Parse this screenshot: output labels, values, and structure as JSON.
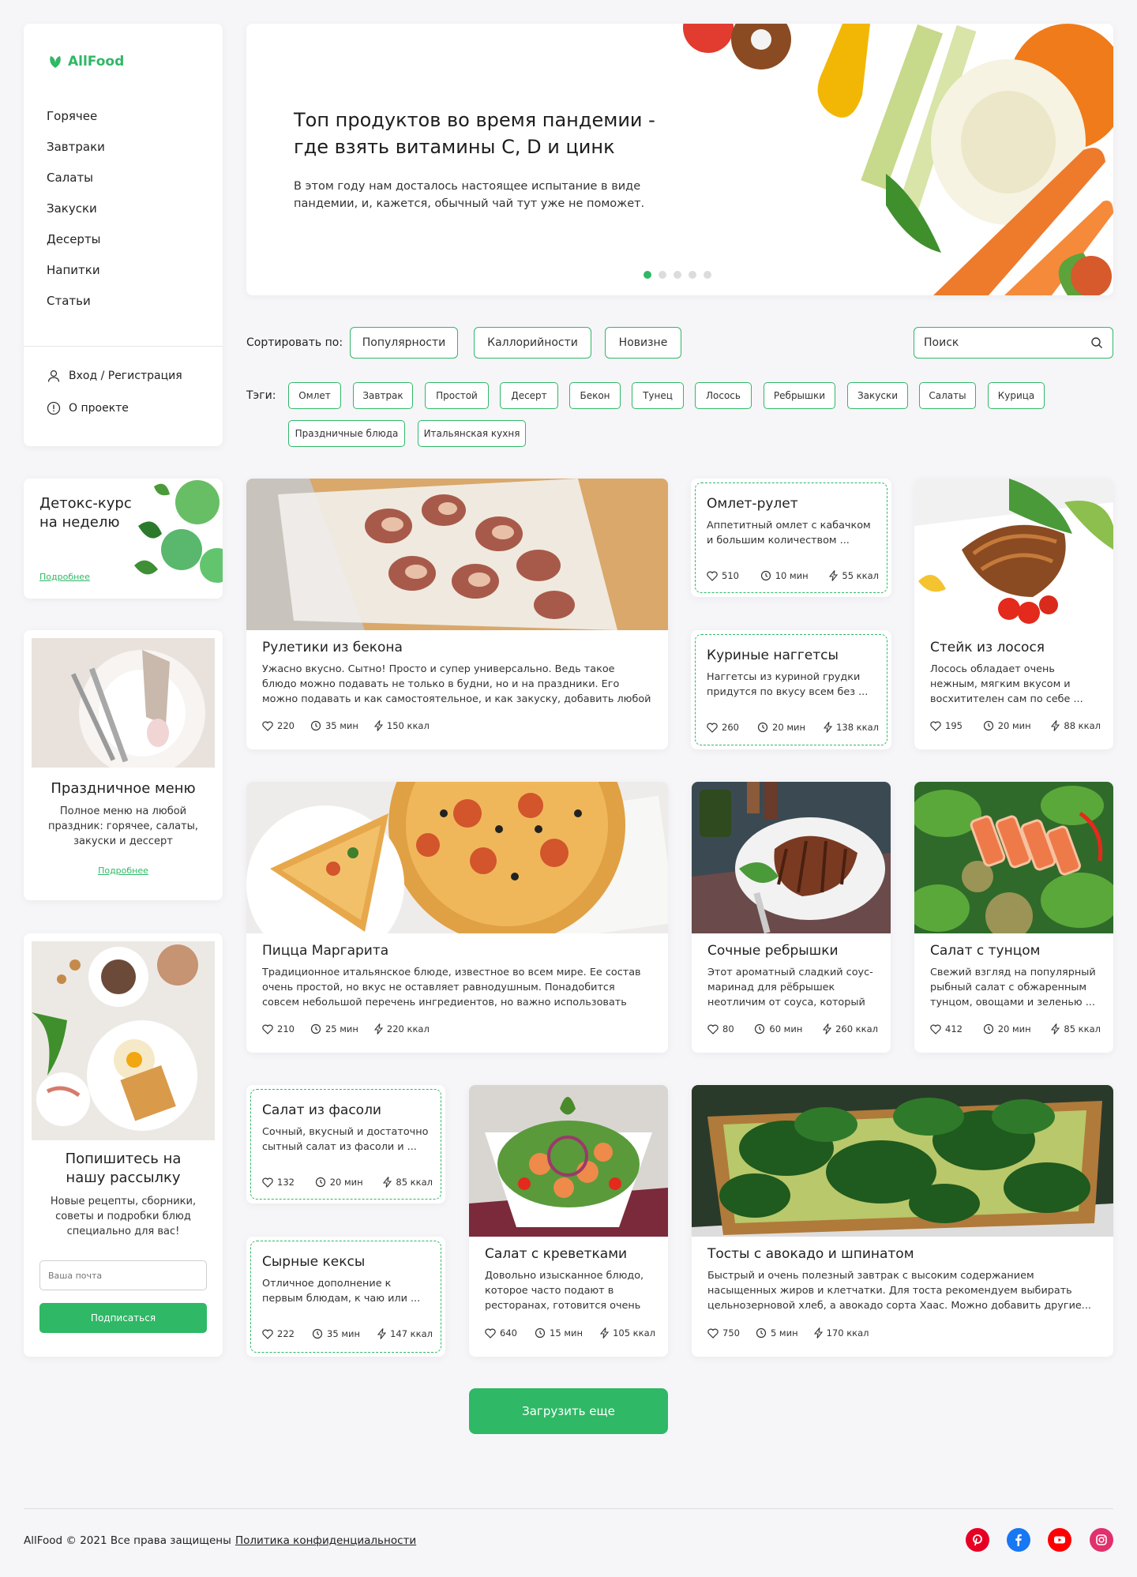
{
  "brand": {
    "name": "AllFood",
    "accent": "#2fb866"
  },
  "nav": [
    "Горячее",
    "Завтраки",
    "Салаты",
    "Закуски",
    "Десерты",
    "Напитки",
    "Статьи"
  ],
  "account": {
    "login": "Вход / Регистрация",
    "about": "О проекте"
  },
  "hero": {
    "title": "Топ продуктов во время пандемии - где взять витамины C, D и цинк",
    "text": "В этом году нам досталось настоящее испытание в виде пандемии, и, кажется, обычный чай тут уже не поможет.",
    "slides": 5,
    "active_slide": 1
  },
  "sort": {
    "label": "Сортировать по:",
    "options": [
      "Популярности",
      "Каллорийности",
      "Новизне"
    ]
  },
  "search": {
    "placeholder": "Поиск"
  },
  "tags": {
    "label": "Тэги:",
    "items": [
      "Омлет",
      "Завтрак",
      "Простой",
      "Десерт",
      "Бекон",
      "Тунец",
      "Лосось",
      "Ребрышки",
      "Закуски",
      "Салаты",
      "Курица",
      "Праздничные блюда",
      "Итальянская кухня"
    ]
  },
  "promo": {
    "detox": {
      "title": "Детокс-курс на неделю",
      "link": "Подробнее"
    },
    "festive": {
      "title": "Праздничное меню",
      "text": "Полное меню на любой праздник: горячее, салаты, закуски и дессерт",
      "link": "Подробнее"
    },
    "newsletter": {
      "title": "Попишитесь на нашу рассылку",
      "text": "Новые рецепты, сборники, советы и подробки блюд специально для вас!",
      "placeholder": "Ваша почта",
      "button": "Подписаться"
    }
  },
  "recipes": [
    {
      "title": "Рулетики из бекона",
      "desc": "Ужасно вкусно. Сытно! Просто и супер универсально. Ведь такое блюдо можно подавать не только в будни, но и на праздники. Его можно подавать и как самостоятельное, и как закуску, добавить любой гарнир ...",
      "likes": "220",
      "time": "35 мин",
      "kcal": "150 ккал"
    },
    {
      "title": "Омлет-рулет",
      "desc": "Аппетитный омлет с кабачком и большим количеством ...",
      "likes": "510",
      "time": "10 мин",
      "kcal": "55 ккал"
    },
    {
      "title": "Куриные наггетсы",
      "desc": "Наггетсы из куриной грудки придутся по вкусу всем без ...",
      "likes": "260",
      "time": "20 мин",
      "kcal": "138 ккал"
    },
    {
      "title": "Стейк из лосося",
      "desc": "Лосось обладает очень нежным, мягким вкусом и восхитителен сам по себе ...",
      "likes": "195",
      "time": "20 мин",
      "kcal": "88 ккал"
    },
    {
      "title": "Пицца Маргарита",
      "desc": "Традиционное итальянское блюде, известное во всем мире. Ее состав очень простой, но вкус не оставляет равнодушным. Понадобится совсем небольшой перечень ингредиентов, но важно использовать именно те ...",
      "likes": "210",
      "time": "25 мин",
      "kcal": "220 ккал"
    },
    {
      "title": "Сочные ребрышки",
      "desc": "Этот ароматный сладкий соус-маринад для рёбрышек неотличим от соуса, который ...",
      "likes": "80",
      "time": "60 мин",
      "kcal": "260 ккал"
    },
    {
      "title": "Салат с тунцом",
      "desc": "Свежий взгляд на популярный рыбный салат с обжаренным тунцом, овощами и зеленью ...",
      "likes": "412",
      "time": "20 мин",
      "kcal": "85 ккал"
    },
    {
      "title": "Салат из фасоли",
      "desc": "Сочный, вкусный и достаточно сытный салат из фасоли и ...",
      "likes": "132",
      "time": "20 мин",
      "kcal": "85 ккал"
    },
    {
      "title": "Сырные討кексы",
      "desc": "",
      "likes": "",
      "time": "",
      "kcal": ""
    },
    {
      "title": "Салат с креветками",
      "desc": "Довольно изысканное блюдо, которое часто подают в ресторанах, готовится очень ...",
      "likes": "640",
      "time": "15 мин",
      "kcal": "105 ккал"
    },
    {
      "title": "Тосты с авокадо и шпинатом",
      "desc": "Быстрый и очень полезный завтрак с высоким содержанием насыщенных жиров и клетчатки. Для тоста рекомендуем выбирать цельнозерновой хлеб, а авокадо сорта Хаас. Можно добавить другие...",
      "likes": "750",
      "time": "5 мин",
      "kcal": "170 ккал"
    }
  ],
  "muffins": {
    "title": "Сырные кексы",
    "desc": "Отличное дополнение к первым блюдам, к чаю или ...",
    "likes": "222",
    "time": "35 мин",
    "kcal": "147 ккал"
  },
  "load_more": "Загрузить еще",
  "footer": {
    "copy": "AllFood © 2021 Все права защищены",
    "policy": "Политика конфиденциальности",
    "social": [
      {
        "icon": "pinterest-icon",
        "color": "#e60023"
      },
      {
        "icon": "facebook-icon",
        "color": "#1877f2"
      },
      {
        "icon": "youtube-icon",
        "color": "#ff0000"
      },
      {
        "icon": "instagram-icon",
        "color": "#e1306c"
      }
    ]
  }
}
